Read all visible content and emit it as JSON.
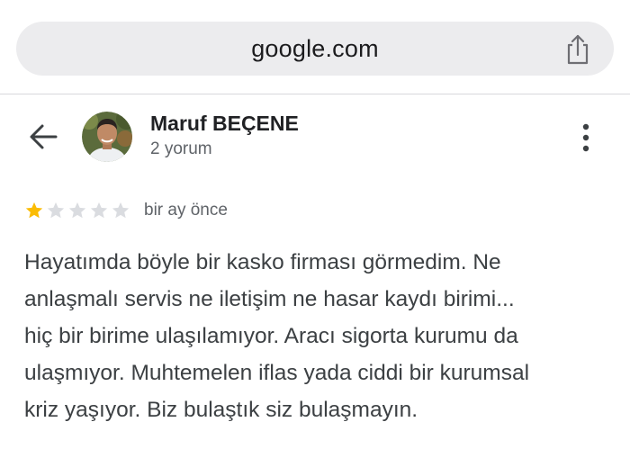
{
  "browser": {
    "address": "google.com",
    "share_icon": "share-icon"
  },
  "header": {
    "back_icon": "arrow-left-icon",
    "reviewer_name": "Maruf BEÇENE",
    "review_count": "2 yorum",
    "more_icon": "more-vertical-icon"
  },
  "review": {
    "rating": 1,
    "max_rating": 5,
    "date": "bir ay önce",
    "lines": [
      "Hayatımda böyle bir kasko firması görmedim. Ne",
      "anlaşmalı servis ne iletişim ne hasar kaydı birimi...",
      "hiç bir birime ulaşılamıyor. Aracı sigorta kurumu da",
      "ulaşmıyor. Muhtemelen iflas yada ciddi bir kurumsal",
      "kriz yaşıyor. Biz bulaştık siz bulaşmayın."
    ]
  },
  "colors": {
    "star_filled": "#fbbc04",
    "star_empty": "#dadce0",
    "text_primary": "#202124",
    "text_secondary": "#5f6368",
    "address_bar_bg": "#ececee"
  }
}
